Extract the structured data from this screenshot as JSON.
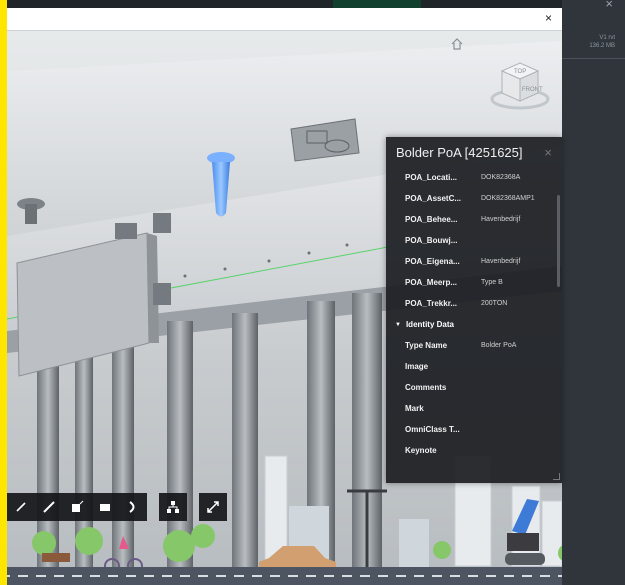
{
  "window": {
    "close_label": "×"
  },
  "right_panel": {
    "close_label": "×",
    "version": "V1 rvt",
    "size": "136.2 MB"
  },
  "dialog": {
    "close_label": "×"
  },
  "viewer": {
    "home_icon": "home-icon",
    "viewcube": {
      "top_label": "TOP",
      "front_label": "FRONT"
    }
  },
  "properties": {
    "title": "Bolder PoA [4251625]",
    "close_label": "×",
    "rows": [
      {
        "key": "POA_Locati...",
        "value": "DOK82368A"
      },
      {
        "key": "POA_AssetC...",
        "value": "DOK82368AMP1"
      },
      {
        "key": "POA_Behee...",
        "value": "Havenbedrijf"
      },
      {
        "key": "POA_Bouwj...",
        "value": ""
      },
      {
        "key": "POA_Eigena...",
        "value": "Havenbedrijf"
      },
      {
        "key": "POA_Meerp...",
        "value": "Type B"
      },
      {
        "key": "POA_Trekkr...",
        "value": "200TON"
      }
    ],
    "section": {
      "label": "Identity Data"
    },
    "identity_rows": [
      {
        "key": "Type Name",
        "value": "Bolder PoA"
      },
      {
        "key": "Image",
        "value": ""
      },
      {
        "key": "Comments",
        "value": ""
      },
      {
        "key": "Mark",
        "value": ""
      },
      {
        "key": "OmniClass T...",
        "value": ""
      },
      {
        "key": "Keynote",
        "value": ""
      }
    ]
  },
  "toolbar": {
    "tools": [
      "orbit-icon",
      "measure-icon",
      "section-icon",
      "explode-icon",
      "model-browser-icon",
      "settings-icon",
      "fullscreen-icon"
    ]
  },
  "colors": {
    "accent": "#ffe600",
    "selection": "#5aa0ff",
    "panel_bg": "#1c1e22"
  }
}
